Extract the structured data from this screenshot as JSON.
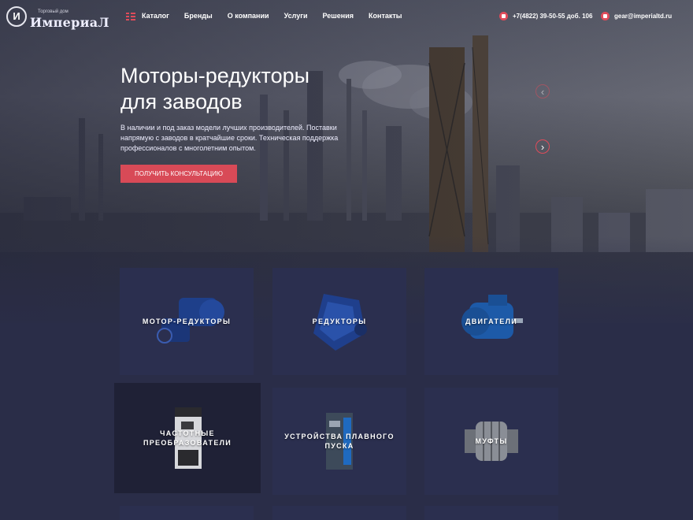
{
  "header": {
    "logo": {
      "subtitle": "Торговый дом",
      "name": "ИмпериаЛ",
      "emblem": "И"
    },
    "nav_icon": "menu-icon",
    "nav": [
      "Каталог",
      "Бренды",
      "О компании",
      "Услуги",
      "Решения",
      "Контакты"
    ],
    "phone": "+7(4822) 39-50-55 доб. 106",
    "email": "gear@imperialtd.ru",
    "phone_icon": "phone-icon",
    "email_icon": "mail-icon"
  },
  "hero": {
    "title_line1": "Моторы-редукторы",
    "title_line2": "для заводов",
    "text": "В наличии и под заказ модели лучших производителей. Поставки напрямую с заводов в кратчайшие сроки. Техническая поддержка профессионалов с многолетним опытом.",
    "cta": "ПОЛУЧИТЬ КОНСУЛЬТАЦИЮ",
    "prev_arrow": "‹",
    "next_arrow": "›"
  },
  "categories": [
    {
      "label": "МОТОР-РЕДУКТОРЫ",
      "icon": "gear-motor-image"
    },
    {
      "label": "РЕДУКТОРЫ",
      "icon": "gearbox-image"
    },
    {
      "label": "ДВИГАТЕЛИ",
      "icon": "electric-motor-image"
    },
    {
      "label": "ЧАСТОТНЫЕ\nПРЕОБРАЗОВАТЕЛИ",
      "icon": "frequency-converter-image"
    },
    {
      "label": "УСТРОЙСТВА ПЛАВНОГО ПУСКА",
      "icon": "soft-starter-image"
    },
    {
      "label": "МУФТЫ",
      "icon": "coupling-image"
    }
  ],
  "colors": {
    "accent": "#e04b5a",
    "tile": "#2b2f4f",
    "page": "#2a2d48"
  }
}
